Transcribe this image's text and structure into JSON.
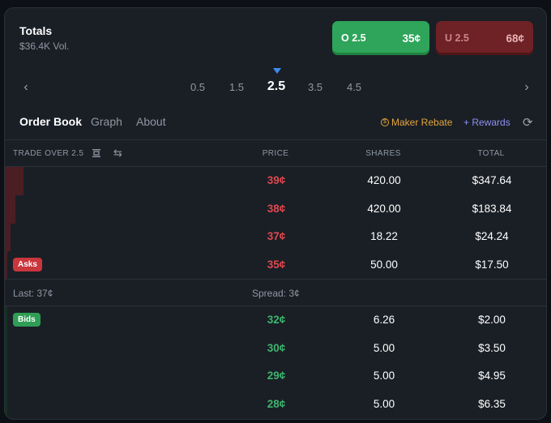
{
  "header": {
    "title": "Totals",
    "volume": "$36.4K Vol."
  },
  "buttons": {
    "over": {
      "label": "O 2.5",
      "price": "35¢"
    },
    "under": {
      "label": "U 2.5",
      "price": "68¢"
    }
  },
  "lines": {
    "options": [
      "0.5",
      "1.5",
      "2.5",
      "3.5",
      "4.5"
    ],
    "selected": "2.5"
  },
  "tabs": {
    "order_book": "Order Book",
    "graph": "Graph",
    "about": "About"
  },
  "rebate": {
    "label": "Maker Rebate",
    "icon": "$"
  },
  "rewards": {
    "label": "+ Rewards"
  },
  "columns": {
    "trade": "TRADE OVER 2.5",
    "price": "PRICE",
    "shares": "SHARES",
    "total": "TOTAL"
  },
  "asks": [
    {
      "price": "39¢",
      "shares": "420.00",
      "total": "$347.64",
      "depth": 0.035
    },
    {
      "price": "38¢",
      "shares": "420.00",
      "total": "$183.84",
      "depth": 0.02
    },
    {
      "price": "37¢",
      "shares": "18.22",
      "total": "$24.24",
      "depth": 0.01
    },
    {
      "price": "35¢",
      "shares": "50.00",
      "total": "$17.50",
      "depth": 0.005
    }
  ],
  "asks_badge": "Asks",
  "spread": {
    "last": "Last: 37¢",
    "spread": "Spread: 3¢"
  },
  "bids_badge": "Bids",
  "bids": [
    {
      "price": "32¢",
      "shares": "6.26",
      "total": "$2.00",
      "depth": 0.005
    },
    {
      "price": "30¢",
      "shares": "5.00",
      "total": "$3.50",
      "depth": 0.005
    },
    {
      "price": "29¢",
      "shares": "5.00",
      "total": "$4.95",
      "depth": 0.005
    },
    {
      "price": "28¢",
      "shares": "5.00",
      "total": "$6.35",
      "depth": 0.005
    }
  ],
  "colors": {
    "accent_green": "#2ea55a",
    "accent_red": "#c9363c",
    "rebate": "#e3a43a",
    "rewards": "#8f8ff2"
  }
}
